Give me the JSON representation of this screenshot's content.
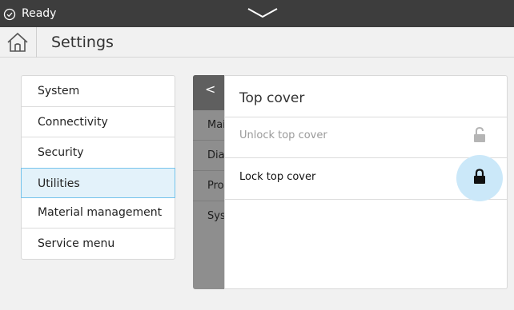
{
  "status_bar": {
    "status": "Ready",
    "ok_icon": "check-circle-icon",
    "expand_icon": "chevron-down-icon"
  },
  "title_bar": {
    "title": "Settings",
    "home_icon": "home-icon"
  },
  "left_menu": {
    "items": [
      {
        "label": "System"
      },
      {
        "label": "Connectivity"
      },
      {
        "label": "Security"
      },
      {
        "label": "Utilities",
        "selected": true
      },
      {
        "label": "Material management"
      },
      {
        "label": "Service menu"
      }
    ]
  },
  "submenu": {
    "back_glyph": "<",
    "items": [
      {
        "label": "Mai"
      },
      {
        "label": "Dia"
      },
      {
        "label": "Pro"
      },
      {
        "label": "Sys"
      }
    ]
  },
  "panel": {
    "title": "Top cover",
    "rows": [
      {
        "label": "Unlock top cover",
        "icon": "unlocked-padlock-icon",
        "state": "disabled"
      },
      {
        "label": "Lock top cover",
        "icon": "padlock-icon",
        "state": "active"
      }
    ]
  },
  "colors": {
    "status_bar": "#3d3d3d",
    "selected_bg": "#e3f2fa",
    "selected_border": "#75c3ec",
    "submenu": "#8e8e8e",
    "highlight": "#cbe8f9"
  }
}
